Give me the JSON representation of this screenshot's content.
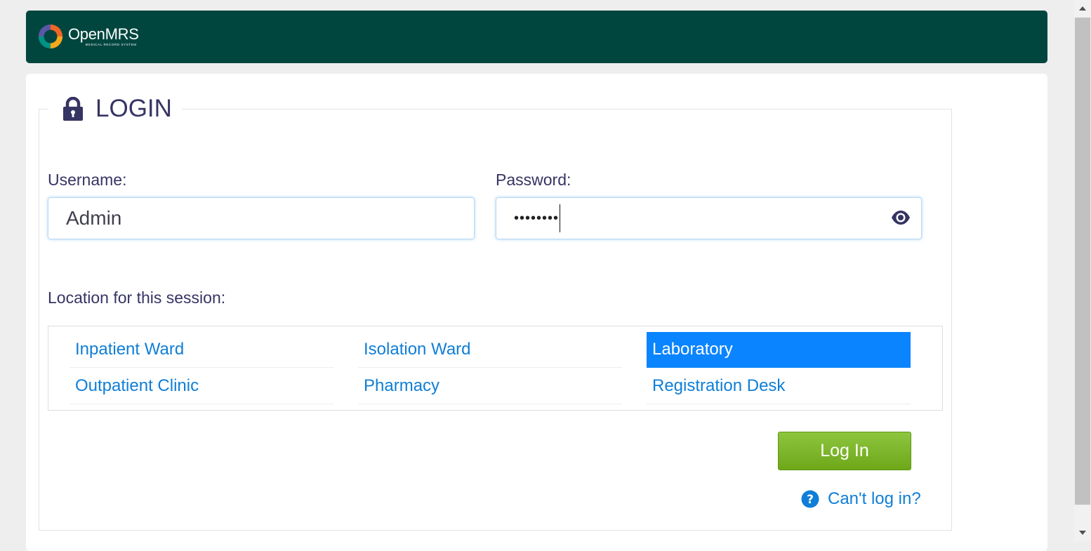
{
  "header": {
    "brand_name": "OpenMRS",
    "brand_tagline": "MEDICAL RECORD SYSTEM",
    "background_color": "#00463f"
  },
  "login": {
    "title": "LOGIN",
    "username_label": "Username:",
    "username_value": "Admin",
    "password_label": "Password:",
    "password_value_masked": "••••••••",
    "location_label": "Location for this session:",
    "locations": [
      {
        "label": "Inpatient Ward",
        "selected": false
      },
      {
        "label": "Isolation Ward",
        "selected": false
      },
      {
        "label": "Laboratory",
        "selected": true
      },
      {
        "label": "Outpatient Clinic",
        "selected": false
      },
      {
        "label": "Pharmacy",
        "selected": false
      },
      {
        "label": "Registration Desk",
        "selected": false
      }
    ],
    "login_button": "Log In",
    "cant_login_link": "Can't log in?"
  },
  "colors": {
    "title": "#363463",
    "link": "#0f7ed7",
    "selected_bg": "#0a84ff",
    "button": "#7cb82f"
  }
}
